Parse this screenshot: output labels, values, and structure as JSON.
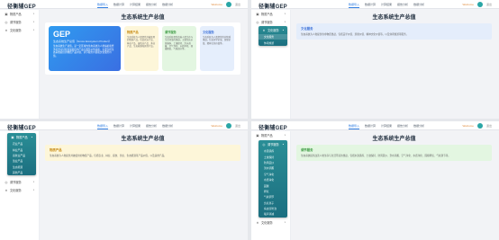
{
  "brand": "径衡辅GEP",
  "nav": [
    "数据导入",
    "数据计算",
    "计算结果",
    "报告分析",
    "数据分析"
  ],
  "user": {
    "name": "Welcome",
    "logout": "退出"
  },
  "sidebar": {
    "items": [
      {
        "label": "物质产品",
        "icon": "box-icon"
      },
      {
        "label": "调节服务",
        "icon": "globe-icon"
      },
      {
        "label": "文化服务",
        "icon": "tools-icon"
      }
    ],
    "chevron": "▾"
  },
  "page_title": "生态系统生产总值",
  "gep_card": {
    "title": "GEP",
    "subtitle": "生态系统生产总值（Gross Ecosystem Product）",
    "desc": "生态系统生产总值，是一定区域内生态系统为人类福祉和经济社会可持续发展提供的产品与服务价值总和，主要包括生态系统提供的物质产品价值、调节服务价值和文化服务价值。"
  },
  "cards": [
    {
      "title": "物质产品",
      "desc": "生态系统为人类提供并被使用的物质产品，包括农业产品、林业产品、畜牧业产品、渔业产品、生态能源和其他产品。"
    },
    {
      "title": "调节服务",
      "desc": "生态系统提供改善人类生存与生活环境的惠益，主要包括水源涵养、土壤保持、洪水调蓄、空气净化、水质净化、固碳释氧、气候调节等。"
    },
    {
      "title": "文化服务",
      "desc": "生态系统为人类提供的非物质惠益，包括美学价值、游憩价值、精神文化价值等。"
    }
  ],
  "panel2": {
    "dropdown_head": "文化服务",
    "sub_items": [
      "文化服务",
      "休闲旅游"
    ],
    "info_title": "文化服务",
    "info_desc": "生态系统为人类提供的非物质惠益，包括美学价值、游憩价值、精神文化价值等，以及休闲旅游等服务。"
  },
  "panel3": {
    "dropdown_head": "物质产品",
    "sub_items": [
      "农业产品",
      "林业产品",
      "畜牧业产品",
      "渔业产品",
      "生态能源",
      "其他产品"
    ],
    "info_title": "物质产品",
    "info_desc": "生态系统为人类提供并被使用的物质产品，包括农业、林业、畜牧、渔业、生态能源等产品价值，以及其他产品。"
  },
  "panel4": {
    "dropdown_head": "调节服务",
    "sub_items": [
      "水源涵养",
      "土壤保持",
      "防风固沙",
      "洪水调蓄",
      "空气净化",
      "水质净化",
      "固碳",
      "释氧",
      "气候调节",
      "负氧离子",
      "病虫害防治",
      "噪声消减"
    ],
    "info_title": "调节服务",
    "info_desc": "生态系统提供改善人类生存与生活环境的惠益，包括水源涵养、土壤保持、防风固沙、洪水调蓄、空气净化、水质净化、固碳释氧、气候调节等。"
  }
}
